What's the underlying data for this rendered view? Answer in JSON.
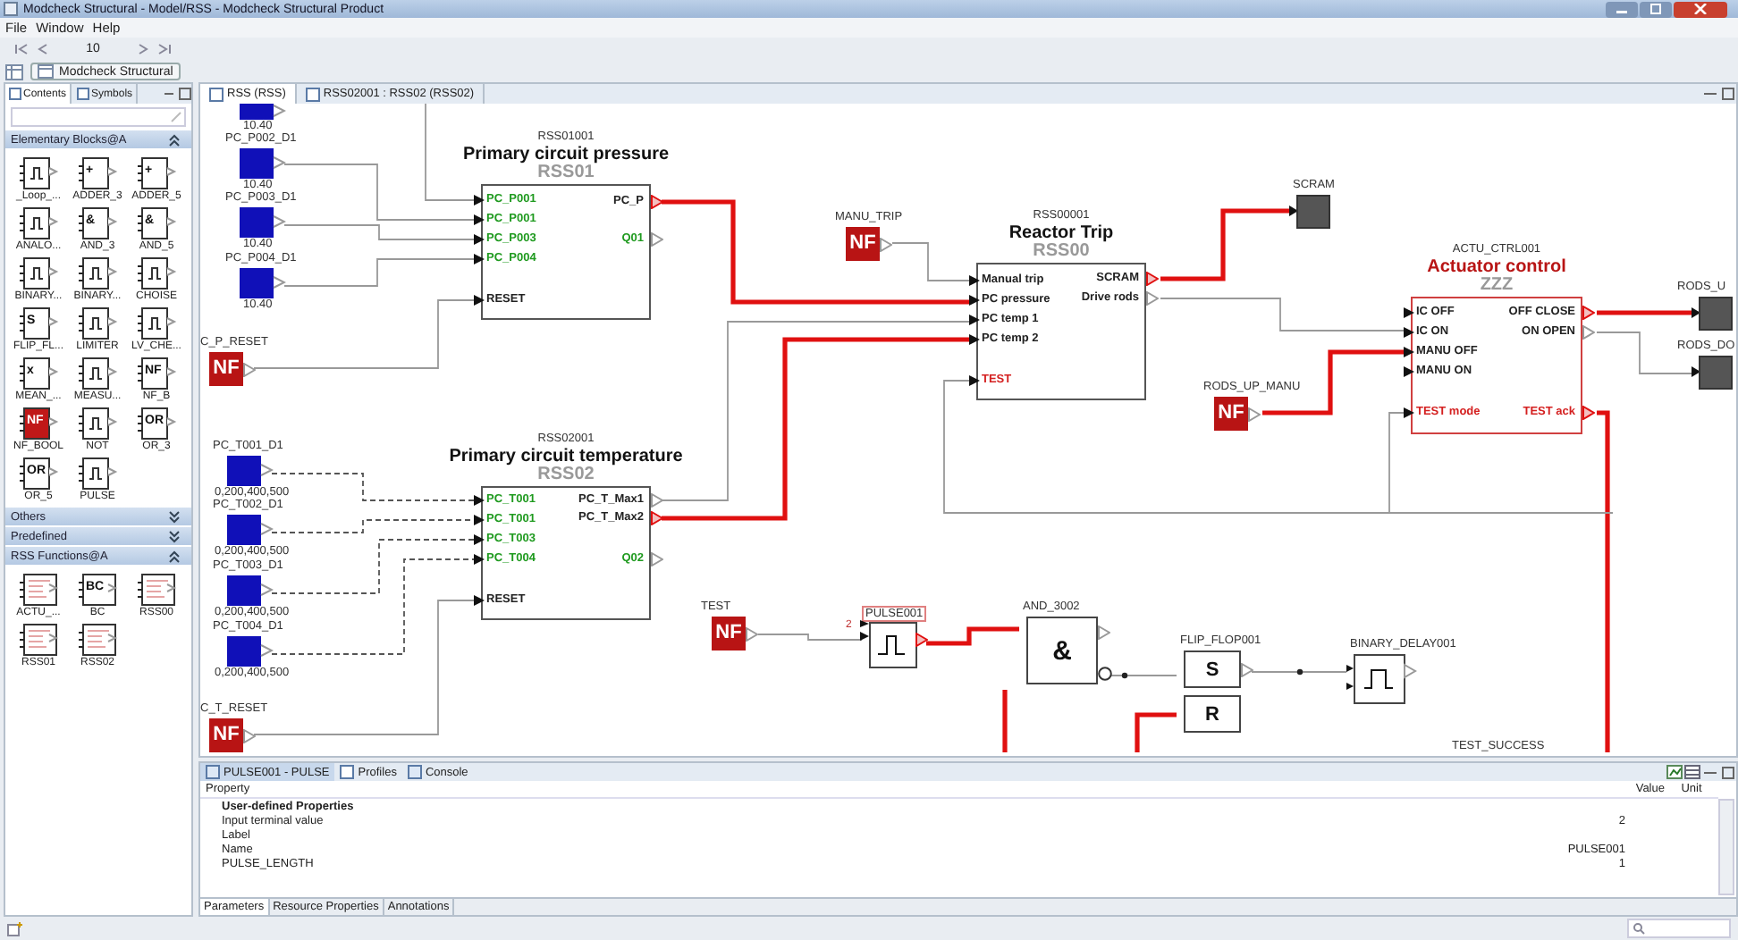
{
  "window": {
    "title": "Modcheck Structural - Model/RSS - Modcheck Structural Product"
  },
  "menu": [
    "File",
    "Window",
    "Help"
  ],
  "toolbar": {
    "zoom": "10"
  },
  "perspective": "Modcheck Structural",
  "left_tabs": [
    {
      "label": "Contents",
      "selected": true
    },
    {
      "label": "Symbols",
      "selected": false
    }
  ],
  "palette": [
    {
      "title": "Elementary Blocks@A",
      "expanded": true,
      "items": [
        {
          "label": "_Loop_..."
        },
        {
          "label": "ADDER_3",
          "glyph": "+"
        },
        {
          "label": "ADDER_5",
          "glyph": "+"
        },
        {
          "label": "ANALO..."
        },
        {
          "label": "AND_3",
          "glyph": "&"
        },
        {
          "label": "AND_5",
          "glyph": "&"
        },
        {
          "label": "BINARY..."
        },
        {
          "label": "BINARY..."
        },
        {
          "label": "CHOISE"
        },
        {
          "label": "FLIP_FL...",
          "glyph": "S"
        },
        {
          "label": "LIMITER"
        },
        {
          "label": "LV_CHE..."
        },
        {
          "label": "MEAN_...",
          "glyph": "x"
        },
        {
          "label": "MEASU..."
        },
        {
          "label": "NF_B",
          "glyph": "NF"
        },
        {
          "label": "NF_BOOL",
          "glyph": "NF"
        },
        {
          "label": "NOT"
        },
        {
          "label": "OR_3",
          "glyph": "OR"
        },
        {
          "label": "OR_5",
          "glyph": "OR"
        },
        {
          "label": "PULSE"
        }
      ]
    },
    {
      "title": "Others",
      "expanded": false
    },
    {
      "title": "Predefined",
      "expanded": false
    },
    {
      "title": "RSS Functions@A",
      "expanded": true,
      "items": [
        {
          "label": "ACTU_..."
        },
        {
          "label": "BC",
          "glyph": "BC"
        },
        {
          "label": "RSS00"
        },
        {
          "label": "RSS01"
        },
        {
          "label": "RSS02"
        }
      ]
    }
  ],
  "editor_tabs": [
    {
      "label": "RSS (RSS)",
      "selected": true
    },
    {
      "label": "RSS02001 : RSS02 (RSS02)",
      "selected": false
    }
  ],
  "diagram": {
    "sensors": [
      {
        "range": "10.40"
      },
      {
        "name": "PC_P002_D1",
        "range": "10.40"
      },
      {
        "name": "PC_P003_D1",
        "range": "10.40"
      },
      {
        "name": "PC_P004_D1",
        "range": "10.40"
      },
      {
        "name": "PC_T001_D1",
        "range": "0,200,400,500"
      },
      {
        "name": "PC_T002_D1",
        "range": "0,200,400,500"
      },
      {
        "name": "PC_T003_D1",
        "range": "0,200,400,500"
      },
      {
        "name": "PC_T004_D1",
        "range": "0,200,400,500"
      }
    ],
    "nf_inputs": [
      {
        "name": "C_P_RESET",
        "glyph": "NF",
        "active": false
      },
      {
        "name": "MANU_TRIP",
        "glyph": "NF",
        "active": false
      },
      {
        "name": "RODS_UP_MANU",
        "glyph": "NF",
        "active": true
      },
      {
        "name": "C_T_RESET",
        "glyph": "NF",
        "active": false
      },
      {
        "name": "TEST",
        "glyph": "NF",
        "active": false
      }
    ],
    "blocks": [
      {
        "instance": "RSS01001",
        "title": "Primary circuit pressure",
        "type": "RSS01",
        "highlighted": false,
        "inputs": [
          {
            "label": "PC_P001",
            "color": "#1f9a1f"
          },
          {
            "label": "PC_P001",
            "color": "#1f9a1f"
          },
          {
            "label": "PC_P003",
            "color": "#1f9a1f"
          },
          {
            "label": "PC_P004",
            "color": "#1f9a1f"
          },
          {
            "label": "RESET",
            "color": "#222222"
          }
        ],
        "outputs": [
          {
            "label": "PC_P",
            "color": "#222222",
            "active": true
          },
          {
            "label": "Q01",
            "color": "#1f9a1f"
          }
        ]
      },
      {
        "instance": "RSS02001",
        "title": "Primary circuit temperature",
        "type": "RSS02",
        "highlighted": false,
        "inputs": [
          {
            "label": "PC_T001",
            "color": "#1f9a1f"
          },
          {
            "label": "PC_T001",
            "color": "#1f9a1f"
          },
          {
            "label": "PC_T003",
            "color": "#1f9a1f"
          },
          {
            "label": "PC_T004",
            "color": "#1f9a1f"
          },
          {
            "label": "RESET",
            "color": "#222222"
          }
        ],
        "outputs": [
          {
            "label": "PC_T_Max1",
            "color": "#222222",
            "active": false
          },
          {
            "label": "PC_T_Max2",
            "color": "#222222",
            "active": true
          },
          {
            "label": "Q02",
            "color": "#1f9a1f"
          }
        ]
      },
      {
        "instance": "RSS00001",
        "title": "Reactor Trip",
        "type": "RSS00",
        "highlighted": false,
        "inputs": [
          {
            "label": "Manual trip",
            "color": "#222222"
          },
          {
            "label": "PC pressure",
            "color": "#222222"
          },
          {
            "label": "PC temp 1",
            "color": "#222222"
          },
          {
            "label": "PC temp 2",
            "color": "#222222"
          },
          {
            "label": "TEST",
            "color": "#d42020"
          }
        ],
        "outputs": [
          {
            "label": "SCRAM",
            "color": "#222222",
            "active": true
          },
          {
            "label": "Drive rods",
            "color": "#222222",
            "active": false
          }
        ]
      },
      {
        "instance": "ACTU_CTRL001",
        "title": "Actuator control",
        "type": "ZZZ",
        "highlighted": true,
        "inputs": [
          {
            "label": "IC OFF",
            "color": "#222222"
          },
          {
            "label": "IC ON",
            "color": "#222222"
          },
          {
            "label": "MANU OFF",
            "color": "#222222"
          },
          {
            "label": "MANU ON",
            "color": "#222222"
          },
          {
            "label": "TEST mode",
            "color": "#d42020"
          }
        ],
        "outputs": [
          {
            "label": "OFF CLOSE",
            "color": "#222222",
            "active": true
          },
          {
            "label": "ON OPEN",
            "color": "#222222",
            "active": false
          },
          {
            "label": "TEST ack",
            "color": "#d42020",
            "active": true
          }
        ]
      }
    ],
    "outputs": [
      {
        "name": "SCRAM"
      },
      {
        "name": "RODS_U"
      },
      {
        "name": "RODS_DO"
      }
    ],
    "small_blocks": [
      {
        "kind": "pulse",
        "name": "PULSE001",
        "input_note": "2",
        "active": true
      },
      {
        "kind": "and",
        "name": "AND_3002",
        "glyph": "&"
      },
      {
        "kind": "flipflop",
        "name": "FLIP_FLOP001",
        "glyph": "S",
        "glyph2": "R"
      },
      {
        "kind": "delay",
        "name": "BINARY_DELAY001"
      }
    ],
    "test_success": {
      "label": "TEST_SUCCESS",
      "active": true
    }
  },
  "bottom_tabs": [
    {
      "label": "PULSE001 - PULSE",
      "selected": true
    },
    {
      "label": "Profiles",
      "selected": false
    },
    {
      "label": "Console",
      "selected": false
    }
  ],
  "properties": {
    "columns": [
      "Property",
      "Value",
      "Unit"
    ],
    "group": "User-defined Properties",
    "rows": [
      {
        "name": "Input terminal value",
        "value": "2"
      },
      {
        "name": "Label"
      },
      {
        "name": "Name",
        "value": "PULSE001"
      },
      {
        "name": "PULSE_LENGTH",
        "value": "1"
      }
    ]
  },
  "property_tabs": [
    {
      "label": "Parameters",
      "selected": true
    },
    {
      "label": "Resource Properties",
      "selected": false
    },
    {
      "label": "Annotations",
      "selected": false
    }
  ]
}
